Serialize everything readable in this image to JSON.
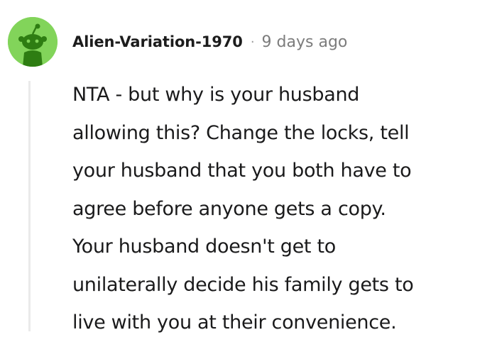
{
  "comment": {
    "author": "Alien-Variation-1970",
    "separator": "·",
    "timestamp": "9 days ago",
    "avatar_icon": "reddit-snoo-avatar-icon",
    "avatar_color": "#82d45a",
    "body": "NTA - but why is your husband\nallowing this? Change the locks, tell\nyour husband that you both have to\nagree before anyone gets a copy.\nYour husband doesn't get to\nunilaterally decide his family gets to\nlive with you at their convenience."
  }
}
